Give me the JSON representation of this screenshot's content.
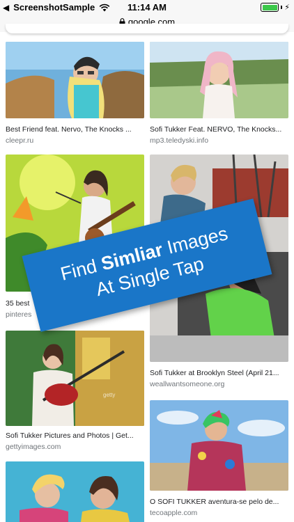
{
  "status_bar": {
    "back_app": "ScreenshotSample",
    "time": "11:14 AM"
  },
  "browser": {
    "url": "google.com"
  },
  "results": [
    {
      "caption": "Best Friend feat. Nervo, The Knocks ...",
      "source": "cleepr.ru"
    },
    {
      "caption": "Sofi Tukker Feat. NERVO, The Knocks...",
      "source": "mp3.teledyski.info"
    },
    {
      "caption": "35 best",
      "source": "pinteres"
    },
    {
      "caption": "Sofi Tukker at Brooklyn Steel (April 21...",
      "source": "weallwantsomeone.org"
    },
    {
      "caption": "Sofi Tukker Pictures and Photos | Get...",
      "source": "gettyimages.com"
    },
    {
      "caption": "O SOFI TUKKER aventura-se pelo de...",
      "source": "tecoapple.com"
    }
  ],
  "promo": {
    "line1_prefix": "Find",
    "line1_bold": "Simliar",
    "line1_suffix": "Images",
    "line2": "At Single Tap"
  },
  "colors": {
    "promo_bg": "#1a76c8",
    "battery": "#3cc84a"
  }
}
